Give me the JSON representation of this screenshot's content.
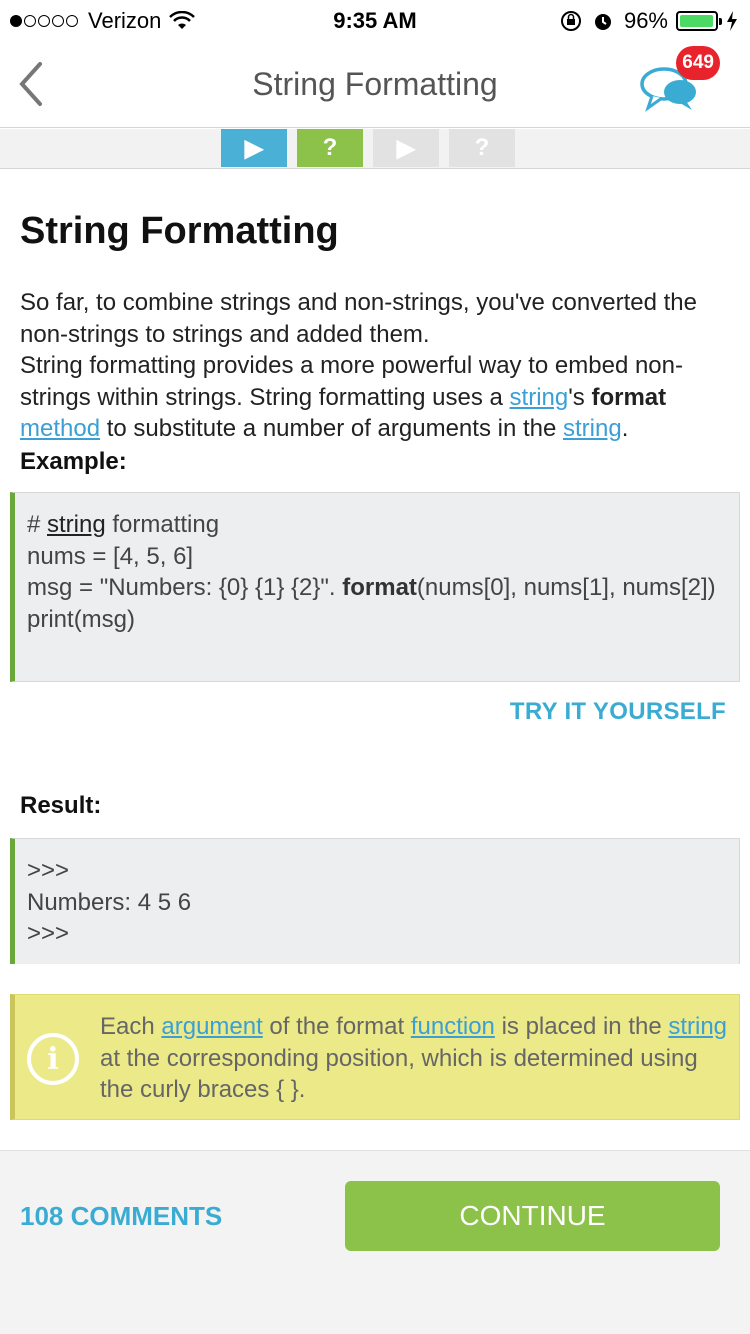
{
  "status_bar": {
    "carrier": "Verizon",
    "time": "9:35 AM",
    "battery_percent": "96%",
    "signal_bars_filled": 1,
    "signal_bars_total": 5
  },
  "nav": {
    "title": "String Formatting",
    "chat_badge": "649"
  },
  "progress": {
    "steps": [
      {
        "type": "play",
        "icon": "▶",
        "state": "active"
      },
      {
        "type": "quiz",
        "icon": "?",
        "state": "completed"
      },
      {
        "type": "play",
        "icon": "▶",
        "state": "locked"
      },
      {
        "type": "quiz",
        "icon": "?",
        "state": "locked"
      }
    ]
  },
  "lesson": {
    "title": "String Formatting",
    "para_1": "So far, to combine strings and non-strings, you've converted the non-strings to strings and added them.",
    "para_2_a": "String formatting provides a more powerful way to embed non-strings within strings. String formatting uses a ",
    "para_2_link_string": "string",
    "para_2_b": "'s ",
    "para_2_bold": "format",
    "para_2_c": " ",
    "para_2_link_method": "method",
    "para_2_d": " to substitute a number of arguments in the ",
    "para_2_link_string2": "string",
    "para_2_e": ".",
    "example_label": "Example:",
    "code": {
      "line1_prefix": "# ",
      "line1_link": "string",
      "line1_suffix": " formatting",
      "line2": "nums = [4, 5, 6]",
      "line3_a": "msg = \"Numbers: {0} {1} {2}\". ",
      "line3_kw": "format",
      "line3_b": "(nums[0], nums[1], nums[2])",
      "line4": "print(msg)"
    },
    "try_it_label": "TRY IT YOURSELF",
    "result_label": "Result:",
    "result_lines": [
      ">>>",
      "Numbers: 4 5 6",
      ">>>"
    ],
    "note": {
      "a": "Each ",
      "link_argument": "argument",
      "b": " of the format ",
      "link_function": "function",
      "c": " is placed in the ",
      "link_string": "string",
      "d": " at the corresponding position, which is determined using the curly braces { }.",
      "icon_glyph": "i"
    }
  },
  "footer": {
    "comments_label": "108 COMMENTS",
    "continue_label": "CONTINUE"
  },
  "colors": {
    "accent_blue": "#3aabd2",
    "accent_green": "#8cc14a",
    "badge_red": "#e8232c",
    "note_bg": "#ece989"
  }
}
